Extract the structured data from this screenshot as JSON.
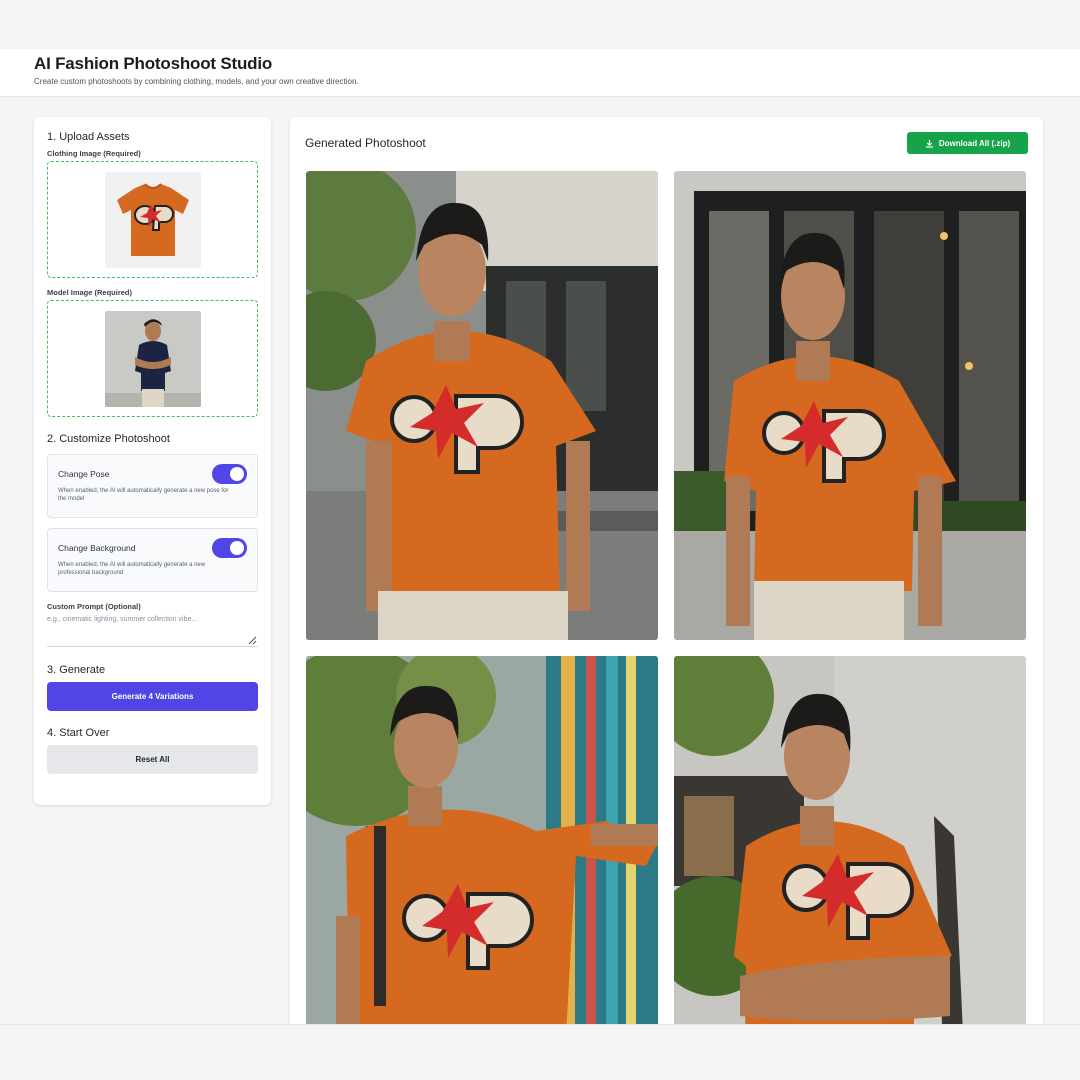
{
  "header": {
    "title": "AI Fashion Photoshoot Studio",
    "subtitle": "Create custom photoshoots by combining clothing, models, and your own creative direction."
  },
  "upload": {
    "section_title": "1. Upload Assets",
    "clothing_label": "Clothing Image (Required)",
    "model_label": "Model Image (Required)"
  },
  "customize": {
    "section_title": "2. Customize Photoshoot",
    "pose": {
      "label": "Change Pose",
      "description": "When enabled, the AI will automatically generate a new pose for the model",
      "enabled": true
    },
    "background": {
      "label": "Change Background",
      "description": "When enabled, the AI will automatically generate a new professional background",
      "enabled": true
    },
    "prompt_label": "Custom Prompt (Optional)",
    "prompt_placeholder": "e.g., cinematic lighting, summer collection vibe..."
  },
  "generate": {
    "section_title": "3. Generate",
    "button_label": "Generate 4 Variations"
  },
  "start_over": {
    "section_title": "4. Start Over",
    "button_label": "Reset All"
  },
  "results": {
    "title": "Generated Photoshoot",
    "download_label": "Download All (.zip)",
    "photos": [
      "generated-photo-1",
      "generated-photo-2",
      "generated-photo-3",
      "generated-photo-4"
    ]
  },
  "colors": {
    "accent": "#4f46e5",
    "download_green": "#16a34a",
    "dropzone_border": "#34c759",
    "tshirt_orange": "#d4691f"
  }
}
